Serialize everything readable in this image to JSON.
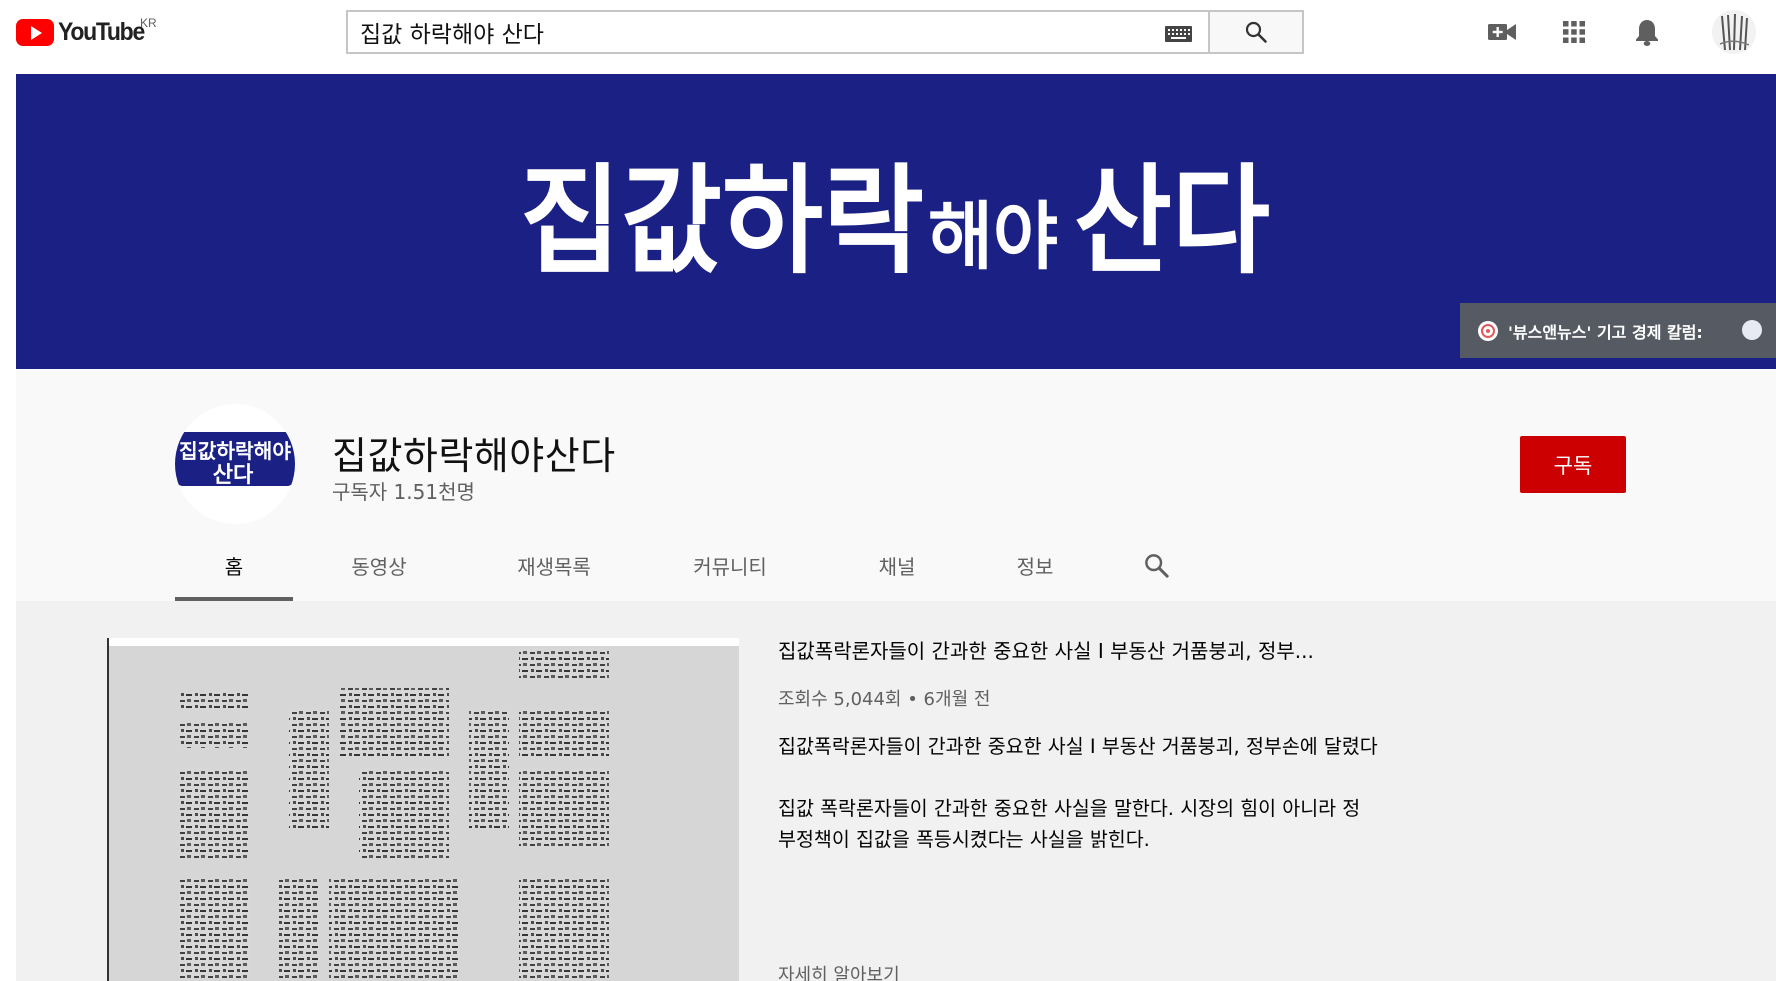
{
  "topbar": {
    "logo_text": "YouTube",
    "region": "KR",
    "search": {
      "value": "집값 하락해야 산다",
      "keyboard_icon": "keyboard-icon",
      "button_icon": "search-icon"
    },
    "icons": [
      "video-create-icon",
      "apps-grid-icon",
      "notifications-bell-icon",
      "account-avatar"
    ]
  },
  "banner": {
    "title_main": "집값하락",
    "title_small": "해야",
    "title_end": "산다",
    "background_color": "#1b2084",
    "link_text": "'뷰스앤뉴스' 기고 경제 칼럼:"
  },
  "channel": {
    "name": "집값하락해야산다",
    "subscribers": "구독자 1.51천명",
    "subscribe_label": "구독",
    "subscribe_color": "#cc0000",
    "avatar_text_line1": "집값하락해야",
    "avatar_text_line2": "산다",
    "tabs": [
      {
        "label": "홈",
        "active": true
      },
      {
        "label": "동영상",
        "active": false
      },
      {
        "label": "재생목록",
        "active": false
      },
      {
        "label": "커뮤니티",
        "active": false
      },
      {
        "label": "채널",
        "active": false
      },
      {
        "label": "정보",
        "active": false
      }
    ]
  },
  "featured_video": {
    "title": "집값폭락론자들이 간과한 중요한 사실 I 부동산 거품붕괴, 정부...",
    "meta": "조회수 5,044회 • 6개월 전",
    "description": [
      "집값폭락론자들이 간과한 중요한 사실 I 부동산 거품붕괴, 정부손에 달렸다",
      "집값 폭락론자들이 간과한 중요한 사실을 말한다. 시장의 힘이 아니라 정부정책이 집값을 폭등시켰다는 사실을 밝힌다."
    ],
    "more_label": "자세히 알아보기"
  }
}
